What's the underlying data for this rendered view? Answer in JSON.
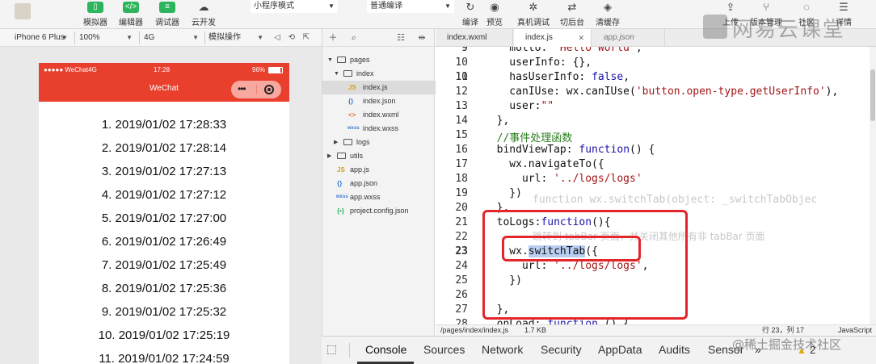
{
  "toolbar": {
    "buttons": [
      {
        "label": "模拟器",
        "icon": "phone-icon"
      },
      {
        "label": "编辑器",
        "icon": "code-icon"
      },
      {
        "label": "调试器",
        "icon": "debug-icon"
      },
      {
        "label": "云开发",
        "icon": "cloud-icon"
      },
      {
        "label": "编译",
        "icon": "refresh-icon"
      },
      {
        "label": "预览",
        "icon": "eye-icon"
      },
      {
        "label": "真机调试",
        "icon": "bug-icon"
      },
      {
        "label": "切后台",
        "icon": "switch-icon"
      },
      {
        "label": "清缓存",
        "icon": "layers-icon"
      },
      {
        "label": "上传",
        "icon": "upload-icon"
      },
      {
        "label": "版本管理",
        "icon": "branch-icon"
      },
      {
        "label": "社区",
        "icon": "chat-icon"
      },
      {
        "label": "详情",
        "icon": "menu-icon"
      }
    ],
    "mode_select": "小程序模式",
    "compile_select": "普通编译"
  },
  "simulator_bar": {
    "device": "iPhone 6 Plus",
    "zoom": "100%",
    "network": "4G",
    "operation": "模拟操作"
  },
  "phone": {
    "carrier": "●●●●● WeChat4G",
    "time": "17:28",
    "battery": "96%",
    "nav_title": "WeChat",
    "logs": [
      "1. 2019/01/02 17:28:33",
      "2. 2019/01/02 17:28:14",
      "3. 2019/01/02 17:27:13",
      "4. 2019/01/02 17:27:12",
      "5. 2019/01/02 17:27:00",
      "6. 2019/01/02 17:26:49",
      "7. 2019/01/02 17:25:49",
      "8. 2019/01/02 17:25:36",
      "9. 2019/01/02 17:25:32",
      "10. 2019/01/02 17:25:19",
      "11. 2019/01/02 17:24:59"
    ]
  },
  "explorer": {
    "tree": [
      {
        "name": "pages",
        "type": "folder",
        "expanded": true
      },
      {
        "name": "index",
        "type": "folder",
        "expanded": true
      },
      {
        "name": "index.js",
        "type": "js",
        "selected": true
      },
      {
        "name": "index.json",
        "type": "json"
      },
      {
        "name": "index.wxml",
        "type": "wxml"
      },
      {
        "name": "index.wxss",
        "type": "wxss"
      },
      {
        "name": "logs",
        "type": "folder",
        "expanded": false
      },
      {
        "name": "utils",
        "type": "folder",
        "expanded": false
      },
      {
        "name": "app.js",
        "type": "js"
      },
      {
        "name": "app.json",
        "type": "json"
      },
      {
        "name": "app.wxss",
        "type": "wxss"
      },
      {
        "name": "project.config.json",
        "type": "config"
      }
    ]
  },
  "editor": {
    "tabs": [
      {
        "label": "index.wxml",
        "active": false
      },
      {
        "label": "index.js",
        "active": true
      },
      {
        "label": "app.json",
        "active": false,
        "preview": true
      }
    ],
    "line_numbers": [
      "9",
      "10",
      "11",
      "12",
      "13",
      "14",
      "15",
      "16",
      "17",
      "18",
      "19",
      "20",
      "21",
      "22",
      "23",
      "24",
      "25",
      "26",
      "27",
      "28"
    ],
    "hint_signature": "function wx.switchTab(object: _switchTabObjec",
    "hint_description": "跳转到 tabBar 页面，并关闭其他所有非 tabBar 页面",
    "status_path": "/pages/index/index.js",
    "status_size": "1.7 KB",
    "status_position": "行 23，列 17",
    "status_language": "JavaScript"
  },
  "devtools": {
    "tabs": [
      "Console",
      "Sources",
      "Network",
      "Security",
      "AppData",
      "Audits",
      "Sensor"
    ],
    "more": "»",
    "warn_count": "2"
  },
  "watermarks": {
    "top": "网易云课堂",
    "bottom": "@稀土掘金技术社区"
  }
}
